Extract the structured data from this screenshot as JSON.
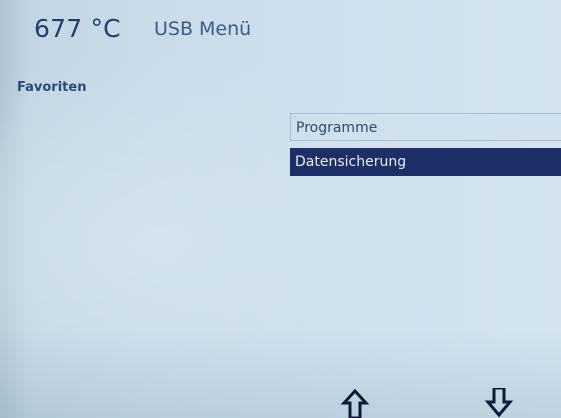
{
  "header": {
    "temperature": "677 °C",
    "title": "USB Menü"
  },
  "favorites_label": "Favoriten",
  "menu": {
    "items": [
      {
        "label": "Programme",
        "selected": false
      },
      {
        "label": "Datensicherung",
        "selected": true
      }
    ]
  },
  "navigation": {
    "up_icon": "arrow-up-icon",
    "down_icon": "arrow-down-icon"
  },
  "colors": {
    "background": "#cadcea",
    "text": "#1f3f6c",
    "selection": "#1d2f66",
    "selection_text": "#e6eef8"
  }
}
